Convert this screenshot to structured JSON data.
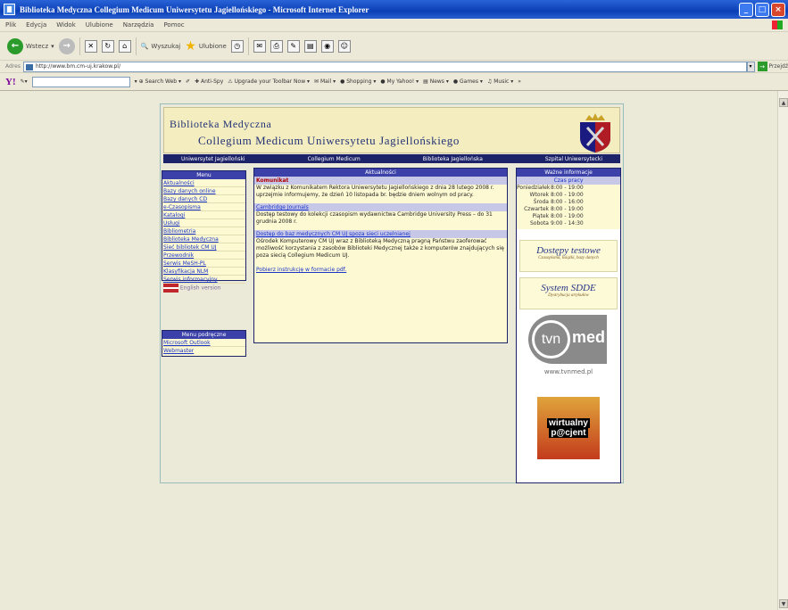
{
  "window": {
    "title": "Biblioteka Medyczna Collegium Medicum Uniwersytetu Jagiellońskiego - Microsoft Internet Explorer"
  },
  "menubar": {
    "items": [
      "Plik",
      "Edycja",
      "Widok",
      "Ulubione",
      "Narzędzia",
      "Pomoc"
    ]
  },
  "toolbar": {
    "back": "Wstecz",
    "search": "Wyszukaj",
    "favorites": "Ulubione"
  },
  "address": {
    "label": "Adres",
    "url": "http://www.bm.cm-uj.krakow.pl/",
    "go": "Przejdź"
  },
  "yahoo": {
    "logo": "Y!",
    "search_web": "Search Web",
    "antispy": "Anti-Spy",
    "upgrade": "Upgrade your Toolbar Now",
    "mail": "Mail",
    "shopping": "Shopping",
    "myyahoo": "My Yahoo!",
    "news": "News",
    "games": "Games",
    "music": "Music"
  },
  "site": {
    "title1": "Biblioteka Medyczna",
    "title2": "Collegium Medicum Uniwersytetu Jagiellońskiego",
    "nav": [
      "Uniwersytet Jagielloński",
      "Collegium Medicum",
      "Biblioteka Jagiellońska",
      "Szpital Uniwersytecki"
    ],
    "menu": {
      "header": "Menu",
      "items": [
        "Aktualności",
        "Bazy danych online",
        "Bazy danych CD",
        "e-Czasopisma",
        "Katalogi",
        "Usługi",
        "Bibliometria",
        "Biblioteka Medyczna",
        "Sieć bibliotek CM UJ",
        "Przewodnik",
        "Serwis MeSH-PL",
        "Klasyfikacja NLM",
        "Serwis informacyjny",
        "English version"
      ]
    },
    "submenu": {
      "header": "Menu podręczne",
      "items": [
        "Microsoft Outlook",
        "Webmaster"
      ]
    },
    "news": {
      "header": "Aktualności",
      "kom_title": "Komunikat",
      "kom_text": "W związku z Komunikatem Rektora Uniwersytetu Jagiellońskiego z dnia 28 lutego 2008 r. uprzejmie informujemy, że dzień 10 listopada br. będzie dniem wolnym od pracy.",
      "cam_title": "Cambridge Journals",
      "cam_text": "Dostęp testowy do kolekcji czasopism wydawnictwa Cambridge University Press – do 31 grudnia 2008 r.",
      "access_title": "Dostęp do baz medycznych CM UJ spoza sieci uczelnianej",
      "access_text": "Ośrodek Komputerowy CM UJ wraz z Biblioteką Medyczną pragną Państwu zaoferować możliwość korzystania z zasobów Biblioteki Medycznej także z komputerów znajdujących się poza siecią Collegium Medicum UJ.",
      "pdf_link": "Pobierz instrukcję w formacie pdf."
    },
    "info": {
      "header": "Ważne informacje",
      "hours_header": "Czas pracy",
      "hours": [
        {
          "day": "Poniedziałek",
          "time": "8:00 - 19:00"
        },
        {
          "day": "Wtorek",
          "time": "8:00 - 19:00"
        },
        {
          "day": "Środa",
          "time": "8:00 - 16:00"
        },
        {
          "day": "Czwartek",
          "time": "8:00 - 19:00"
        },
        {
          "day": "Piątek",
          "time": "8:00 - 19:00"
        },
        {
          "day": "Sobota",
          "time": "9:00 - 14:30"
        }
      ],
      "promo1_title": "Dostępy testowe",
      "promo1_sub": "Czasopisma, książki, bazy danych",
      "promo2_title": "System SDDE",
      "promo2_sub": "Dystrybucja artykułów",
      "tvn_logo": "tvn",
      "tvn_med": "med",
      "tvn_url": "www.tvnmed.pl",
      "wp_line1": "wirtualny",
      "wp_line2": "p@cjent"
    }
  }
}
